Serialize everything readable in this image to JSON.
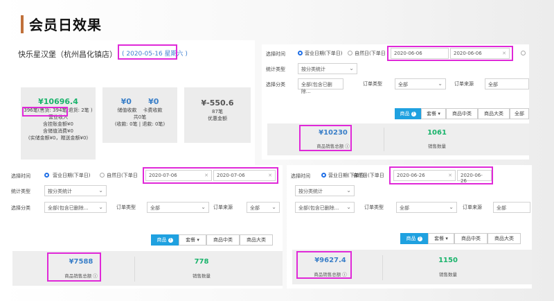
{
  "slide_title": "会员日效果",
  "panel_a": {
    "shop_name": "快乐星汉堡（杭州昌化镇店）",
    "date": "( 2020-05-16 星期六 )",
    "card1": {
      "amount": "¥10696.4",
      "count": "396笔(售货: 394笔",
      "refund": "退货: 2笔 )",
      "l1": "营业收入",
      "l2": "含挂账金额¥0",
      "l3": "含储值消费¥0",
      "l4": "(实储金额¥0，赠送金额¥0)"
    },
    "card2": {
      "v1": "¥0",
      "v2": "¥0",
      "l1": "储值收款",
      "l2": "卡费收款",
      "l3": "共0笔",
      "l4": "(收款: 0笔 | 退款: 0笔)"
    },
    "card3": {
      "amount": "¥-550.6",
      "count": "87笔",
      "label": "优惠金额"
    }
  },
  "labels": {
    "select_time": "选择时间",
    "business_day": "营业日期(下单日)",
    "natural_day": "自然日(下单日",
    "stat_type": "统计类型",
    "by_category": "按分类统计",
    "select_category": "选择分类",
    "all_incl_deleted": "全部(包含已删除...",
    "order_type": "订单类型",
    "all": "全部",
    "order_source": "订单来源",
    "tab_goods": "商品",
    "tab_combo": "套餐",
    "tab_mid_cat": "商品中类",
    "tab_big_cat": "商品大类",
    "tab_all_short": "全部",
    "sales_total_label": "商品销售总额",
    "sales_qty_label": "销售数量"
  },
  "panel_b": {
    "date_from": "2020-06-06",
    "date_to": "2020-06-06",
    "sales_total": "¥10230",
    "sales_qty": "1061"
  },
  "panel_c": {
    "date_from": "2020-07-06",
    "date_to": "2020-07-06",
    "sales_total": "¥7588",
    "sales_qty": "778"
  },
  "panel_d": {
    "date_from": "2020-06-26",
    "date_to": "2020-06-26",
    "sales_total": "¥9627.4",
    "sales_qty": "1150"
  }
}
